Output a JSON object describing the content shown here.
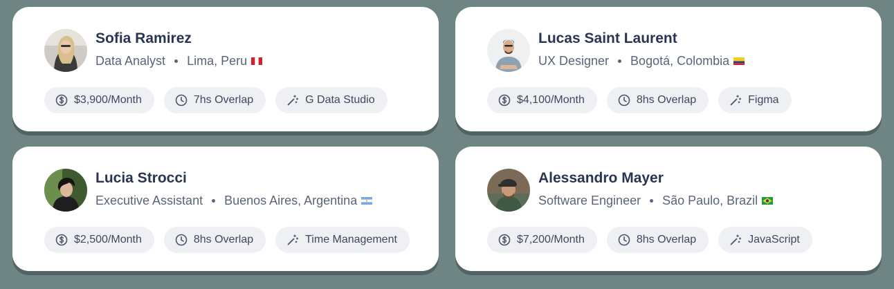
{
  "colors": {
    "background": "#6f8583",
    "card": "#ffffff",
    "name_text": "#2a3553",
    "meta_text": "#5a6478",
    "chip_bg": "#eef0f4"
  },
  "cards": [
    {
      "name": "Sofia Ramirez",
      "role": "Data Analyst",
      "location": "Lima, Peru",
      "flag": "peru-flag",
      "salary": "$3,900/Month",
      "overlap": "7hs Overlap",
      "skill": "G Data Studio"
    },
    {
      "name": "Lucas Saint Laurent",
      "role": "UX Designer",
      "location": "Bogotá, Colombia",
      "flag": "colombia-flag",
      "salary": "$4,100/Month",
      "overlap": "8hs Overlap",
      "skill": "Figma"
    },
    {
      "name": "Lucia Strocci",
      "role": "Executive Assistant",
      "location": "Buenos Aires, Argentina",
      "flag": "argentina-flag",
      "salary": "$2,500/Month",
      "overlap": "8hs Overlap",
      "skill": "Time Management"
    },
    {
      "name": "Alessandro Mayer",
      "role": "Software Engineer",
      "location": "São Paulo, Brazil",
      "flag": "brazil-flag",
      "salary": "$7,200/Month",
      "overlap": "8hs Overlap",
      "skill": "JavaScript"
    }
  ],
  "icons": {
    "salary": "dollar-circle-icon",
    "overlap": "clock-icon",
    "skill": "magic-wand-icon"
  }
}
